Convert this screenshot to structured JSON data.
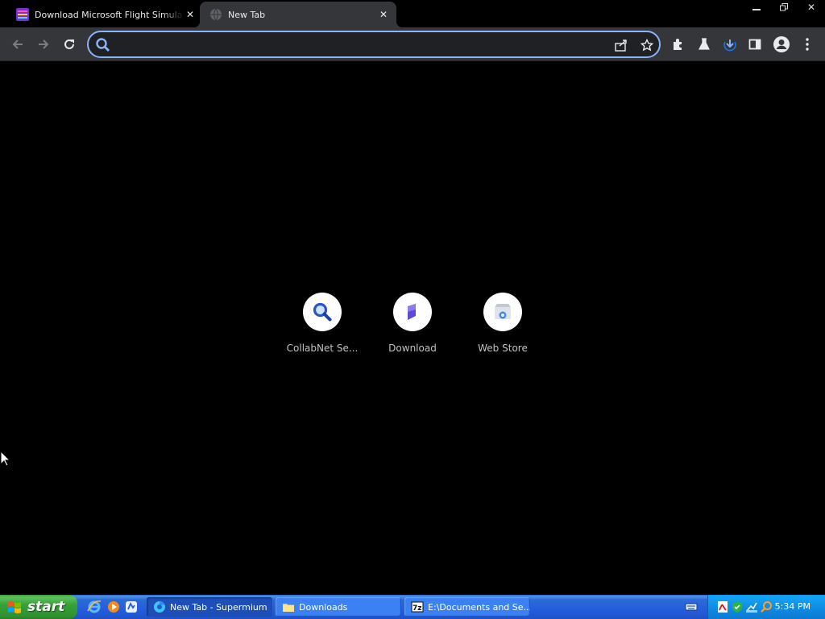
{
  "browser": {
    "tabs": [
      {
        "title": "Download Microsoft Flight Simulator",
        "icon": "app-favicon",
        "active": false
      },
      {
        "title": "New Tab",
        "icon": "globe-icon",
        "active": true
      }
    ],
    "omnibox": {
      "value": "",
      "placeholder": ""
    }
  },
  "newtab": {
    "shortcuts": [
      {
        "label": "CollabNet Se...",
        "icon": "magnifier-icon"
      },
      {
        "label": "Download",
        "icon": "download-site-icon"
      },
      {
        "label": "Web Store",
        "icon": "web-store-icon"
      }
    ]
  },
  "taskbar": {
    "start_label": "start",
    "tasks": [
      {
        "label": "New Tab - Supermium",
        "icon": "browser-icon",
        "active": true
      },
      {
        "label": "Downloads",
        "icon": "folder-icon",
        "active": false
      },
      {
        "label": "E:\\Documents and Se...",
        "icon": "7zip-icon",
        "active": false
      }
    ],
    "clock": "5:34 PM"
  },
  "colors": {
    "accent": "#8ab4f8",
    "toolbar": "#35363a",
    "taskbar": "#245edc",
    "start": "#37a237"
  }
}
